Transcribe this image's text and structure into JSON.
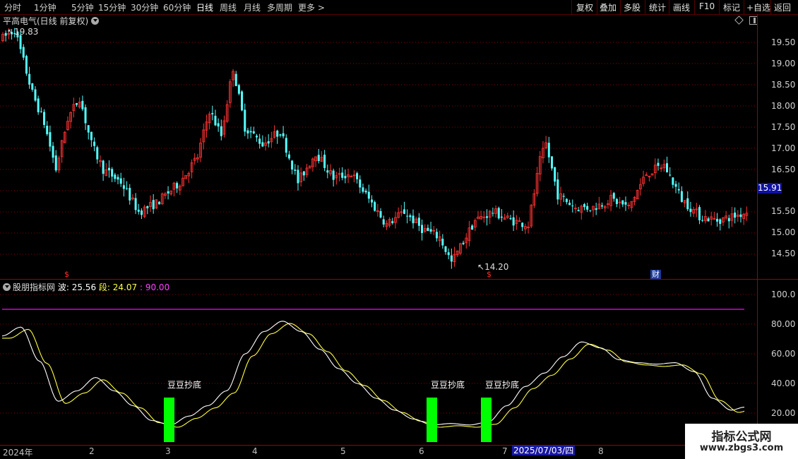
{
  "toolbar": {
    "left_items": [
      "分时",
      "1分钟",
      "5分钟",
      "15分钟",
      "30分钟",
      "60分钟",
      "日线",
      "周线",
      "月线",
      "多周期",
      "更多 >"
    ],
    "active_item": "日线",
    "right_items": [
      "复权",
      "叠加",
      "多股",
      "统计",
      "画线",
      "F10",
      "标记",
      "+自选",
      "返回"
    ]
  },
  "main_chart": {
    "title": "平高电气(日线 前复权)",
    "high_label": "19.83",
    "low_label": "14.20",
    "current_price": "15.91",
    "y_ticks": [
      "19.50",
      "19.00",
      "18.50",
      "18.00",
      "17.50",
      "17.00",
      "16.50",
      "16.00",
      "15.50",
      "15.00",
      "14.50"
    ],
    "event_marker": "财",
    "s_marker": "$"
  },
  "indicator": {
    "name": "股朋指标网",
    "wave_label": "波:",
    "wave_value": "25.56",
    "segment_label": "段:",
    "segment_value": "24.07",
    "level_label": ":",
    "level_value": "90.00",
    "y_ticks": [
      "100.0",
      "80.00",
      "60.00",
      "40.00",
      "20.00"
    ],
    "signal_text": "豆豆抄底"
  },
  "x_axis": {
    "labels": [
      "2024年",
      "2",
      "3",
      "4",
      "5",
      "6",
      "7",
      "8"
    ],
    "cursor_date": "2025/07/03/四"
  },
  "watermark": {
    "line1": "指标公式网",
    "line2": "www.zbgs3.com"
  },
  "colors": {
    "up": "#ff3232",
    "down": "#54ffff",
    "line_white": "#ffffff",
    "line_yellow": "#ffff40",
    "level_line": "#ff00ff",
    "signal_bar": "#00ff00",
    "grid": "#8a0000"
  }
}
